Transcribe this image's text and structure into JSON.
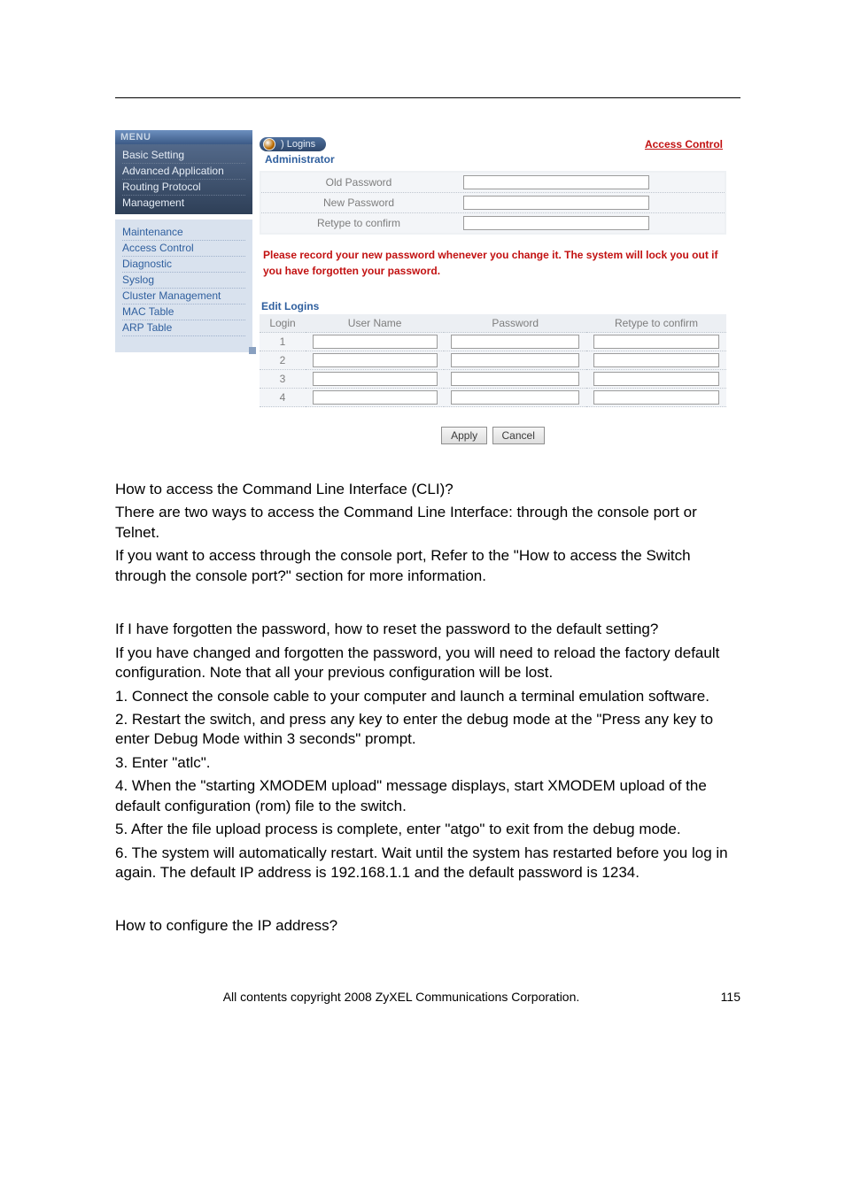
{
  "menu": {
    "header": "MENU",
    "dark_items": [
      "Basic Setting",
      "Advanced Application",
      "Routing Protocol",
      "Management"
    ],
    "light_items": [
      "Maintenance",
      "Access Control",
      "Diagnostic",
      "Syslog",
      "Cluster Management",
      "MAC Table",
      "ARP Table"
    ]
  },
  "panel": {
    "pill_label": ") Logins",
    "access_link": "Access Control",
    "admin_label": "Administrator",
    "rows": [
      {
        "label": "Old Password"
      },
      {
        "label": "New Password"
      },
      {
        "label": "Retype to confirm"
      }
    ],
    "warning": "Please record your new password whenever you change it. The system will lock you out if you have forgotten your password.",
    "edit_heading": "Edit Logins",
    "columns": {
      "login": "Login",
      "user": "User Name",
      "pass": "Password",
      "retype": "Retype to confirm"
    },
    "logins": [
      {
        "n": "1"
      },
      {
        "n": "2"
      },
      {
        "n": "3"
      },
      {
        "n": "4"
      }
    ],
    "apply": "Apply",
    "cancel": "Cancel"
  },
  "faq": {
    "q1": "How to access the Command Line Interface (CLI)?",
    "a1a": "There are two ways to access the Command Line Interface: through the console port or Telnet.",
    "a1b": "If you want to access through the console port, Refer to the \"How to access the Switch through the console port?\" section for more information.",
    "q2": "If I have forgotten the password, how to reset the password to the default setting?",
    "a2a": "If you have changed and forgotten the password, you will need to reload the factory default configuration. Note that all your previous configuration will be lost.",
    "a2b": "1. Connect the console cable to your computer and launch a terminal emulation software.",
    "a2c": "2. Restart the switch, and press any key to enter the debug mode at the \"Press any key to enter Debug Mode within 3 seconds\" prompt.",
    "a2d": "3. Enter \"atlc\".",
    "a2e": "4. When the \"starting XMODEM upload\" message displays, start XMODEM upload of the default configuration (rom) file to the switch.",
    "a2f": "5. After the file upload process is complete, enter \"atgo\" to exit from the debug mode.",
    "a2g": "6. The system will automatically restart. Wait until the system has restarted before you log in again. The default IP address is 192.168.1.1 and the default password is 1234.",
    "q3": "How to configure the IP address?"
  },
  "footer": {
    "copy": "All contents copyright 2008 ZyXEL Communications Corporation.",
    "page": "115"
  }
}
